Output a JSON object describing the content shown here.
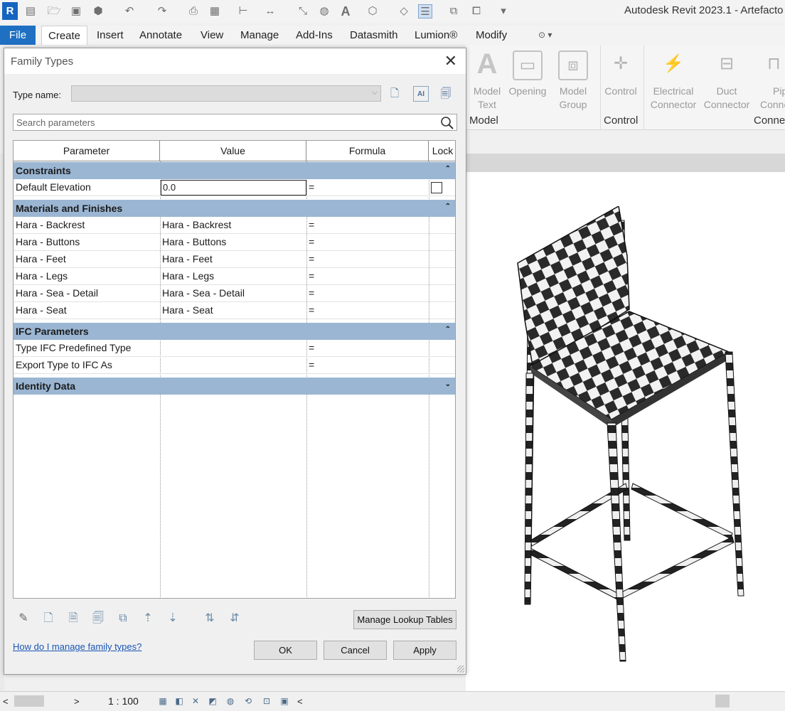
{
  "app": {
    "logo_letter": "R",
    "title": "Autodesk Revit 2023.1 - Artefacto"
  },
  "quick_access": {
    "icons": [
      "open-icon",
      "save-icon",
      "sync-icon",
      "undo-icon",
      "redo-icon",
      "print-icon",
      "measure-icon",
      "dimension-icon",
      "text-icon",
      "3d-view-icon",
      "switch-windows-icon",
      "customize-icon"
    ]
  },
  "menu": {
    "tabs": [
      "File",
      "Create",
      "Insert",
      "Annotate",
      "View",
      "Manage",
      "Add-Ins",
      "Datasmith",
      "Lumion®",
      "Modify"
    ]
  },
  "ribbon": {
    "tools": [
      {
        "label1": "Model",
        "label2": "Text"
      },
      {
        "label1": "Opening",
        "label2": ""
      },
      {
        "label1": "Model",
        "label2": "Group"
      },
      {
        "label1": "Control",
        "label2": ""
      },
      {
        "label1": "Electrical",
        "label2": "Connector"
      },
      {
        "label1": "Duct",
        "label2": "Connector"
      },
      {
        "label1": "Pip",
        "label2": "Conne"
      }
    ],
    "panels": [
      "Model",
      "Control",
      "Conne"
    ]
  },
  "dialog": {
    "title": "Family Types",
    "type_name_label": "Type name:",
    "type_name_value": "",
    "search_placeholder": "Search parameters",
    "columns": [
      "Parameter",
      "Value",
      "Formula",
      "Lock"
    ],
    "groups": {
      "constraints": "Constraints",
      "materials": "Materials and Finishes",
      "ifc": "IFC Parameters",
      "identity": "Identity Data"
    },
    "default_elevation": {
      "param": "Default Elevation",
      "value": "0.0",
      "formula": "="
    },
    "materials_rows": [
      {
        "param": "Hara - Backrest",
        "value": "Hara - Backrest",
        "formula": "="
      },
      {
        "param": "Hara - Buttons",
        "value": "Hara - Buttons",
        "formula": "="
      },
      {
        "param": "Hara - Feet",
        "value": "Hara - Feet",
        "formula": "="
      },
      {
        "param": "Hara - Legs",
        "value": "Hara - Legs",
        "formula": "="
      },
      {
        "param": "Hara - Sea - Detail",
        "value": "Hara - Sea - Detail",
        "formula": "="
      },
      {
        "param": "Hara - Seat",
        "value": "Hara - Seat",
        "formula": "="
      }
    ],
    "ifc_rows": [
      {
        "param": "Type IFC Predefined Type",
        "value": "",
        "formula": "="
      },
      {
        "param": "Export Type to IFC As",
        "value": "",
        "formula": "="
      }
    ],
    "manage_lookup_label": "Manage Lookup Tables",
    "help_link": "How do I manage family types?",
    "ok_label": "OK",
    "cancel_label": "Cancel",
    "apply_label": "Apply"
  },
  "status": {
    "scale": "1 : 100"
  },
  "colors": {
    "group_header": "#9bb6d3",
    "file_tab": "#1f70c2",
    "link": "#1a55b5"
  }
}
